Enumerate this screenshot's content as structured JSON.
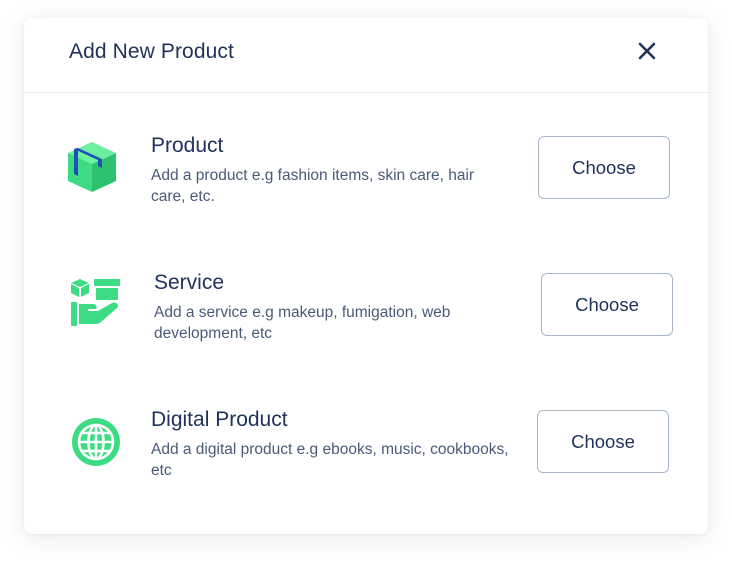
{
  "modal": {
    "title": "Add New Product"
  },
  "options": [
    {
      "title": "Product",
      "description": "Add a product e.g fashion items, skin care, hair care, etc.",
      "button_label": "Choose",
      "icon": "box-icon"
    },
    {
      "title": "Service",
      "description": "Add a service e.g makeup, fumigation, web development, etc",
      "button_label": "Choose",
      "icon": "service-hand-icon"
    },
    {
      "title": "Digital Product",
      "description": "Add a digital product e.g ebooks, music, cookbooks, etc",
      "button_label": "Choose",
      "icon": "globe-icon"
    }
  ],
  "colors": {
    "accent_green": "#3ddc84",
    "accent_blue": "#1f4fb8",
    "text_primary": "#21335a",
    "text_secondary": "#4a5a78",
    "border": "#a9b6c8"
  }
}
